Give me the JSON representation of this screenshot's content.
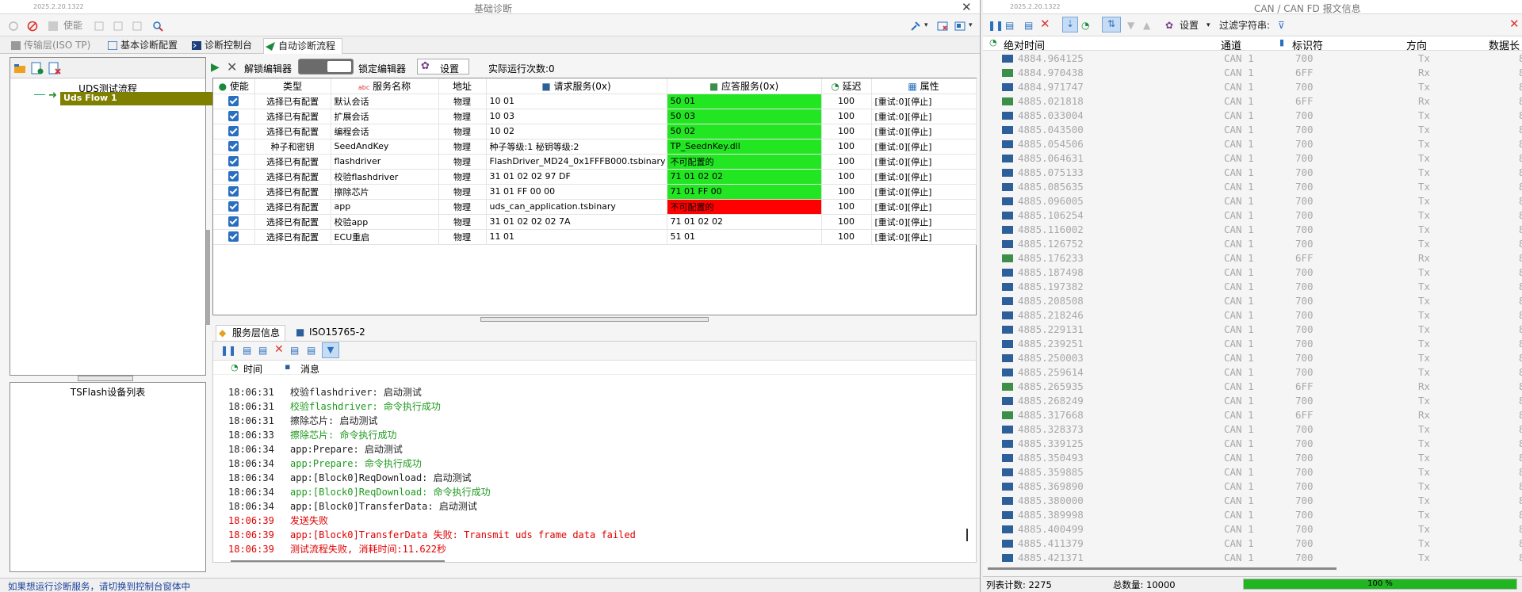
{
  "left_window": {
    "version": "2025.2.20.1322",
    "title": "基础诊断",
    "close": "✕",
    "toolbar": {
      "enable_label": "使能"
    },
    "tabs": [
      "传输层(ISO TP)",
      "基本诊断配置",
      "诊断控制台",
      "自动诊断流程"
    ],
    "flow_tree": {
      "header": "UDS测试流程",
      "items": [
        "Uds Flow 1"
      ]
    },
    "device_list": {
      "header": "TSFlash设备列表"
    },
    "editor_bar": {
      "unlock_label": "解锁编辑器",
      "lock_label": "锁定编辑器",
      "settings_label": "设置",
      "run_count": "实际运行次数:0"
    },
    "table": {
      "headers": [
        "使能",
        "类型",
        "服务名称",
        "地址",
        "请求服务(0x)",
        "应答服务(0x)",
        "延迟",
        "属性"
      ],
      "rows": [
        {
          "type": "选择已有配置",
          "name": "默认会话",
          "addr": "物理",
          "req": "10 01",
          "resp": "50 01",
          "resp_status": "green",
          "delay": "100",
          "attr": "[重试:0][停止]"
        },
        {
          "type": "选择已有配置",
          "name": "扩展会话",
          "addr": "物理",
          "req": "10 03",
          "resp": "50 03",
          "resp_status": "green",
          "delay": "100",
          "attr": "[重试:0][停止]"
        },
        {
          "type": "选择已有配置",
          "name": "编程会话",
          "addr": "物理",
          "req": "10 02",
          "resp": "50 02",
          "resp_status": "green",
          "delay": "100",
          "attr": "[重试:0][停止]"
        },
        {
          "type": "种子和密钥",
          "name": "SeedAndKey",
          "addr": "物理",
          "req": "种子等级:1 秘钥等级:2",
          "resp": "TP_SeednKey.dll",
          "resp_status": "green",
          "delay": "100",
          "attr": "[重试:0][停止]"
        },
        {
          "type": "选择已有配置",
          "name": "flashdriver",
          "addr": "物理",
          "req": "FlashDriver_MD24_0x1FFFB000.tsbinary",
          "resp": "不可配置的",
          "resp_status": "green",
          "delay": "100",
          "attr": "[重试:0][停止]"
        },
        {
          "type": "选择已有配置",
          "name": "校验flashdriver",
          "addr": "物理",
          "req": "31 01 02 02 97 DF",
          "resp": "71 01 02 02",
          "resp_status": "green",
          "delay": "100",
          "attr": "[重试:0][停止]"
        },
        {
          "type": "选择已有配置",
          "name": "擦除芯片",
          "addr": "物理",
          "req": "31 01 FF 00 00",
          "resp": "71 01 FF 00",
          "resp_status": "green",
          "delay": "100",
          "attr": "[重试:0][停止]"
        },
        {
          "type": "选择已有配置",
          "name": "app",
          "addr": "物理",
          "req": "uds_can_application.tsbinary",
          "resp": "不可配置的",
          "resp_status": "red",
          "delay": "100",
          "attr": "[重试:0][停止]"
        },
        {
          "type": "选择已有配置",
          "name": "校验app",
          "addr": "物理",
          "req": "31 01 02 02 02 7A",
          "resp": "71 01 02 02",
          "resp_status": "none",
          "delay": "100",
          "attr": "[重试:0][停止]"
        },
        {
          "type": "选择已有配置",
          "name": "ECU重启",
          "addr": "物理",
          "req": "11 01",
          "resp": "51 01",
          "resp_status": "none",
          "delay": "100",
          "attr": "[重试:0][停止]"
        }
      ]
    },
    "bottom_tabs": [
      "服务层信息",
      "ISO15765-2"
    ],
    "log": {
      "col_time": "时间",
      "col_msg": "消息",
      "entries": [
        {
          "time": "18:06:31",
          "msg": "校验flashdriver: 启动测试",
          "color": "black"
        },
        {
          "time": "18:06:31",
          "msg": "校验flashdriver: 命令执行成功",
          "color": "green"
        },
        {
          "time": "18:06:31",
          "msg": "擦除芯片: 启动测试",
          "color": "black"
        },
        {
          "time": "18:06:33",
          "msg": "擦除芯片: 命令执行成功",
          "color": "green"
        },
        {
          "time": "18:06:34",
          "msg": "app:Prepare: 启动测试",
          "color": "black"
        },
        {
          "time": "18:06:34",
          "msg": "app:Prepare: 命令执行成功",
          "color": "green"
        },
        {
          "time": "18:06:34",
          "msg": "app:[Block0]ReqDownload: 启动测试",
          "color": "black"
        },
        {
          "time": "18:06:34",
          "msg": "app:[Block0]ReqDownload: 命令执行成功",
          "color": "green"
        },
        {
          "time": "18:06:34",
          "msg": "app:[Block0]TransferData: 启动测试",
          "color": "black"
        },
        {
          "time": "18:06:39",
          "msg": "发送失败",
          "color": "red"
        },
        {
          "time": "18:06:39",
          "msg": "app:[Block0]TransferData 失败: Transmit uds frame data failed",
          "color": "red"
        },
        {
          "time": "18:06:39",
          "msg": "测试流程失败, 消耗时间:11.622秒",
          "color": "red"
        }
      ]
    },
    "status": "如果想运行诊断服务，请切换到控制台窗体中"
  },
  "right_window": {
    "version": "2025.2.20.1322",
    "title": "CAN / CAN FD 报文信息",
    "toolbar": {
      "settings_label": "设置",
      "filter_label": "过滤字符串:"
    },
    "columns": [
      "绝对时间",
      "通道",
      "标识符",
      "方向",
      "数据长"
    ],
    "messages": [
      {
        "time": "4884.964125",
        "ch": "CAN 1",
        "id": "700",
        "dir": "Tx",
        "kind": "tx"
      },
      {
        "time": "4884.970438",
        "ch": "CAN 1",
        "id": "6FF",
        "dir": "Rx",
        "kind": "rx"
      },
      {
        "time": "4884.971747",
        "ch": "CAN 1",
        "id": "700",
        "dir": "Tx",
        "kind": "tx"
      },
      {
        "time": "4885.021818",
        "ch": "CAN 1",
        "id": "6FF",
        "dir": "Rx",
        "kind": "rx"
      },
      {
        "time": "4885.033004",
        "ch": "CAN 1",
        "id": "700",
        "dir": "Tx",
        "kind": "tx"
      },
      {
        "time": "4885.043500",
        "ch": "CAN 1",
        "id": "700",
        "dir": "Tx",
        "kind": "tx"
      },
      {
        "time": "4885.054506",
        "ch": "CAN 1",
        "id": "700",
        "dir": "Tx",
        "kind": "tx"
      },
      {
        "time": "4885.064631",
        "ch": "CAN 1",
        "id": "700",
        "dir": "Tx",
        "kind": "tx"
      },
      {
        "time": "4885.075133",
        "ch": "CAN 1",
        "id": "700",
        "dir": "Tx",
        "kind": "tx"
      },
      {
        "time": "4885.085635",
        "ch": "CAN 1",
        "id": "700",
        "dir": "Tx",
        "kind": "tx"
      },
      {
        "time": "4885.096005",
        "ch": "CAN 1",
        "id": "700",
        "dir": "Tx",
        "kind": "tx"
      },
      {
        "time": "4885.106254",
        "ch": "CAN 1",
        "id": "700",
        "dir": "Tx",
        "kind": "tx"
      },
      {
        "time": "4885.116002",
        "ch": "CAN 1",
        "id": "700",
        "dir": "Tx",
        "kind": "tx"
      },
      {
        "time": "4885.126752",
        "ch": "CAN 1",
        "id": "700",
        "dir": "Tx",
        "kind": "tx"
      },
      {
        "time": "4885.176233",
        "ch": "CAN 1",
        "id": "6FF",
        "dir": "Rx",
        "kind": "rx"
      },
      {
        "time": "4885.187498",
        "ch": "CAN 1",
        "id": "700",
        "dir": "Tx",
        "kind": "tx"
      },
      {
        "time": "4885.197382",
        "ch": "CAN 1",
        "id": "700",
        "dir": "Tx",
        "kind": "tx"
      },
      {
        "time": "4885.208508",
        "ch": "CAN 1",
        "id": "700",
        "dir": "Tx",
        "kind": "tx"
      },
      {
        "time": "4885.218246",
        "ch": "CAN 1",
        "id": "700",
        "dir": "Tx",
        "kind": "tx"
      },
      {
        "time": "4885.229131",
        "ch": "CAN 1",
        "id": "700",
        "dir": "Tx",
        "kind": "tx"
      },
      {
        "time": "4885.239251",
        "ch": "CAN 1",
        "id": "700",
        "dir": "Tx",
        "kind": "tx"
      },
      {
        "time": "4885.250003",
        "ch": "CAN 1",
        "id": "700",
        "dir": "Tx",
        "kind": "tx"
      },
      {
        "time": "4885.259614",
        "ch": "CAN 1",
        "id": "700",
        "dir": "Tx",
        "kind": "tx"
      },
      {
        "time": "4885.265935",
        "ch": "CAN 1",
        "id": "6FF",
        "dir": "Rx",
        "kind": "rx"
      },
      {
        "time": "4885.268249",
        "ch": "CAN 1",
        "id": "700",
        "dir": "Tx",
        "kind": "tx"
      },
      {
        "time": "4885.317668",
        "ch": "CAN 1",
        "id": "6FF",
        "dir": "Rx",
        "kind": "rx"
      },
      {
        "time": "4885.328373",
        "ch": "CAN 1",
        "id": "700",
        "dir": "Tx",
        "kind": "tx"
      },
      {
        "time": "4885.339125",
        "ch": "CAN 1",
        "id": "700",
        "dir": "Tx",
        "kind": "tx"
      },
      {
        "time": "4885.350493",
        "ch": "CAN 1",
        "id": "700",
        "dir": "Tx",
        "kind": "tx"
      },
      {
        "time": "4885.359885",
        "ch": "CAN 1",
        "id": "700",
        "dir": "Tx",
        "kind": "tx"
      },
      {
        "time": "4885.369890",
        "ch": "CAN 1",
        "id": "700",
        "dir": "Tx",
        "kind": "tx"
      },
      {
        "time": "4885.380000",
        "ch": "CAN 1",
        "id": "700",
        "dir": "Tx",
        "kind": "tx"
      },
      {
        "time": "4885.389998",
        "ch": "CAN 1",
        "id": "700",
        "dir": "Tx",
        "kind": "tx"
      },
      {
        "time": "4885.400499",
        "ch": "CAN 1",
        "id": "700",
        "dir": "Tx",
        "kind": "tx"
      },
      {
        "time": "4885.411379",
        "ch": "CAN 1",
        "id": "700",
        "dir": "Tx",
        "kind": "tx"
      },
      {
        "time": "4885.421371",
        "ch": "CAN 1",
        "id": "700",
        "dir": "Tx",
        "kind": "tx"
      }
    ],
    "status": {
      "list_count": "列表计数: 2275",
      "total_count": "总数量: 10000",
      "progress_text": "100 %",
      "progress": 1.0
    }
  },
  "colors": {
    "success": "#22e622",
    "failure": "#ff0000",
    "log_green": "#1f9a1f",
    "log_red": "#e00000",
    "selected_flow": "#808000"
  }
}
